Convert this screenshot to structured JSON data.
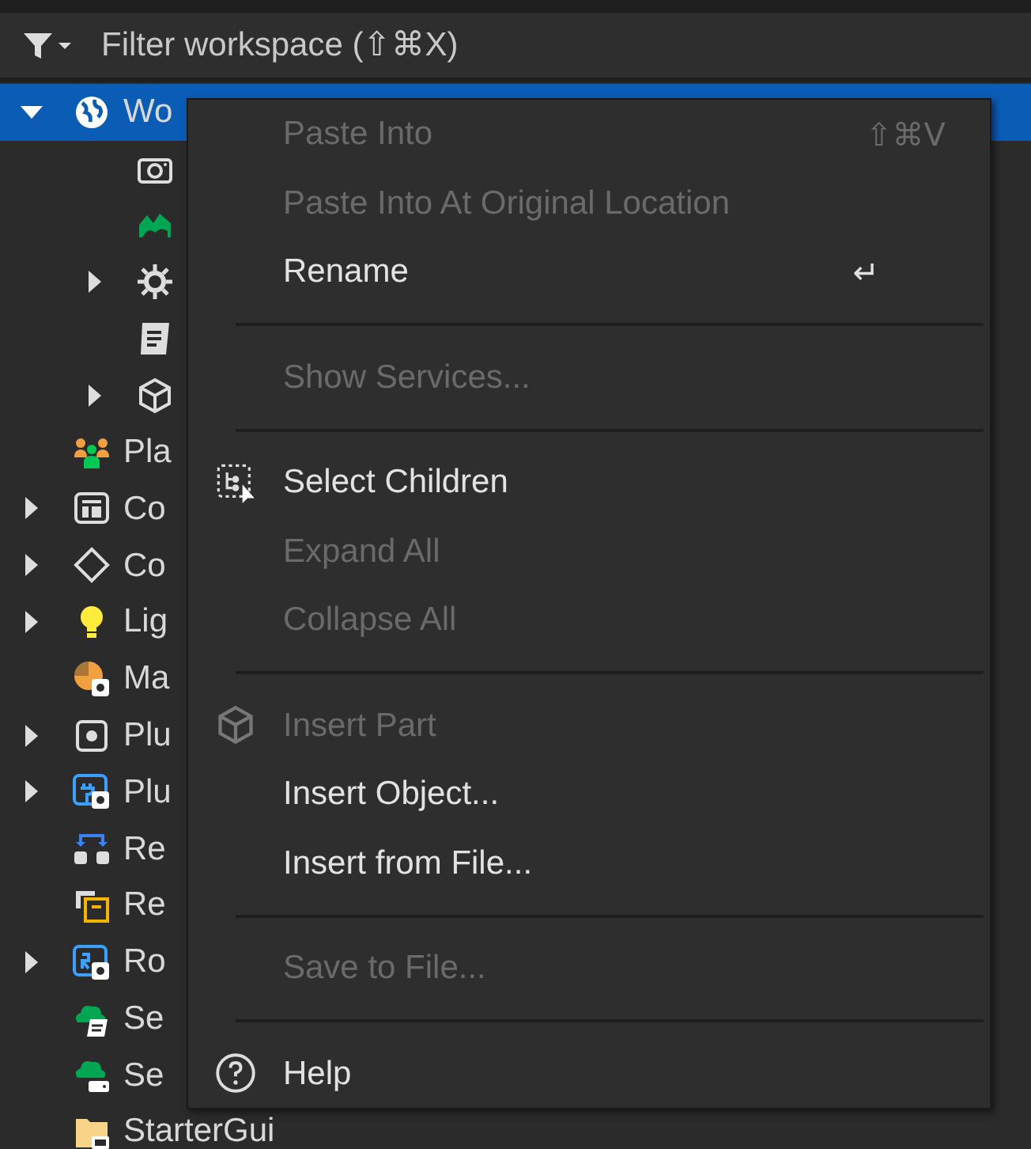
{
  "filter": {
    "placeholder": "Filter workspace (⇧⌘X)"
  },
  "tree": [
    {
      "label": "Wo",
      "selected": true,
      "expanded": true,
      "children": [
        {
          "selected": false
        },
        {
          "selected": false
        },
        {
          "selected": false,
          "expanded": false
        },
        {
          "selected": false
        },
        {
          "selected": false,
          "expanded": false
        }
      ]
    },
    {
      "label": "Pla",
      "selected": false
    },
    {
      "label": "Co",
      "selected": false,
      "expanded": false
    },
    {
      "label": "Co",
      "selected": false,
      "expanded": false
    },
    {
      "label": "Lig",
      "selected": false,
      "expanded": false
    },
    {
      "label": "Ma",
      "selected": false
    },
    {
      "label": "Plu",
      "selected": false,
      "expanded": false
    },
    {
      "label": "Plu",
      "selected": false,
      "expanded": false
    },
    {
      "label": "Re",
      "selected": false
    },
    {
      "label": "Re",
      "selected": false
    },
    {
      "label": "Ro",
      "selected": false,
      "expanded": false
    },
    {
      "label": "Se",
      "selected": false
    },
    {
      "label": "Se",
      "selected": false
    },
    {
      "label": "StarterGui",
      "selected": false
    }
  ],
  "context_menu": [
    {
      "kind": "item",
      "label": "Paste Into",
      "shortcut": "⇧⌘V",
      "disabled": true
    },
    {
      "kind": "item",
      "label": "Paste Into At Original Location",
      "disabled": true
    },
    {
      "kind": "item",
      "label": "Rename",
      "shortcut": "↵",
      "disabled": false
    },
    {
      "kind": "separator"
    },
    {
      "kind": "item",
      "label": "Show Services...",
      "disabled": true
    },
    {
      "kind": "separator"
    },
    {
      "kind": "item",
      "label": "Select Children",
      "disabled": false
    },
    {
      "kind": "item",
      "label": "Expand All",
      "disabled": true
    },
    {
      "kind": "item",
      "label": "Collapse All",
      "disabled": true
    },
    {
      "kind": "separator"
    },
    {
      "kind": "item",
      "label": "Insert Part",
      "disabled": true
    },
    {
      "kind": "item",
      "label": "Insert Object...",
      "disabled": false
    },
    {
      "kind": "item",
      "label": "Insert from File...",
      "disabled": false
    },
    {
      "kind": "separator"
    },
    {
      "kind": "item",
      "label": "Save to File...",
      "disabled": true
    },
    {
      "kind": "separator"
    },
    {
      "kind": "item",
      "label": "Help",
      "disabled": false
    }
  ]
}
